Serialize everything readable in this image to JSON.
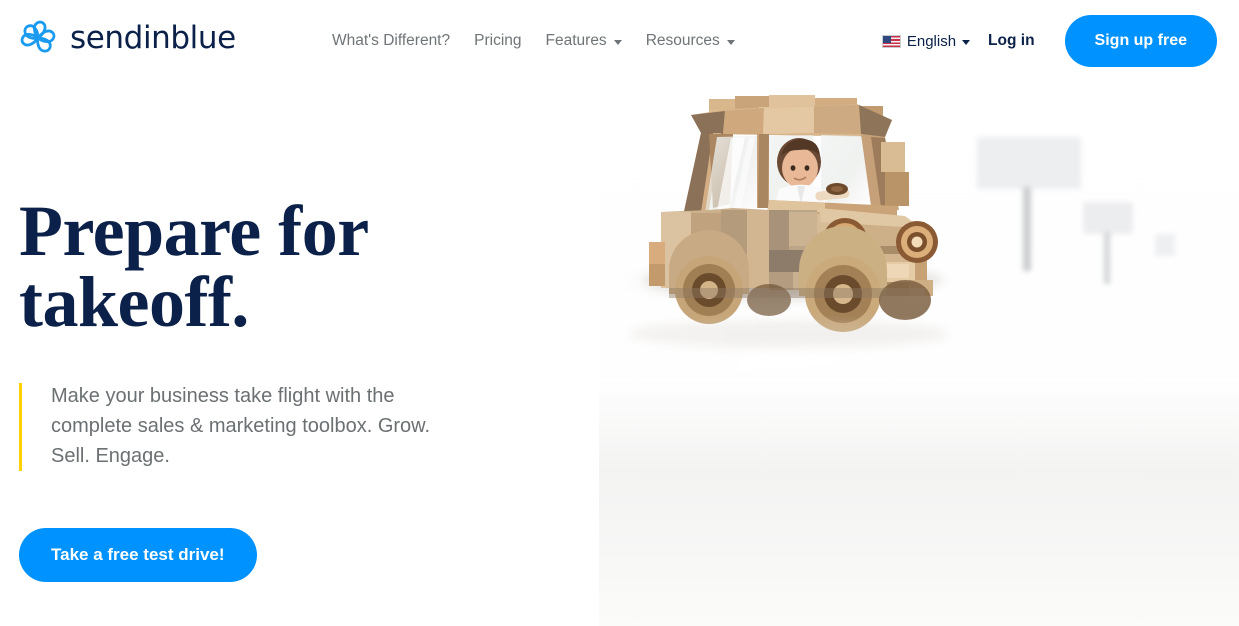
{
  "brand": {
    "name": "sendinblue",
    "logo_icon": "pinwheel-spiral-icon",
    "logo_color": "#1a9bf0",
    "wordmark_color": "#0b2149"
  },
  "header": {
    "nav": [
      {
        "label": "What's Different?",
        "has_dropdown": false
      },
      {
        "label": "Pricing",
        "has_dropdown": false
      },
      {
        "label": "Features",
        "has_dropdown": true
      },
      {
        "label": "Resources",
        "has_dropdown": true
      }
    ],
    "language": {
      "label": "English",
      "flag_icon": "us-flag-icon",
      "has_dropdown": true
    },
    "login_label": "Log in",
    "signup_label": "Sign up free",
    "signup_color": "#0092ff",
    "nav_link_color": "#6e7477"
  },
  "hero": {
    "headline_line1": "Prepare for",
    "headline_line2": "takeoff.",
    "headline_color": "#0b2149",
    "subtitle": "Make your business take flight with the complete sales & marketing toolbox. Grow. Sell. Engage.",
    "accent_bar_color": "#ffd100",
    "subtitle_color": "#6b7073",
    "cta_label": "Take a free test drive!",
    "cta_color": "#0092ff",
    "image_alt": "wooden-toy-block-car-with-boy-driver-on-white-road"
  }
}
